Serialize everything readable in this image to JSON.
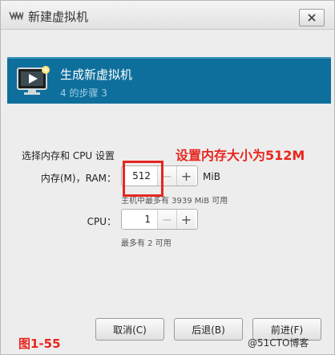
{
  "window": {
    "title": "新建虚拟机",
    "app_icon": "virt-manager-logo",
    "close_icon": "close-icon"
  },
  "banner": {
    "icon": "monitor-play-icon",
    "title": "生成新虚拟机",
    "subtitle": "4 的步骤 3"
  },
  "section": {
    "label": "选择内存和 CPU 设置"
  },
  "memory": {
    "label": "内存(M)，RAM：",
    "value": "512",
    "unit": "MiB",
    "hint": "主机中最多有 3939 MiB 可用",
    "minus": "−",
    "plus": "+"
  },
  "cpu": {
    "label": "CPU：",
    "value": "1",
    "hint": "最多有 2 可用",
    "minus": "−",
    "plus": "+"
  },
  "annotation": {
    "text": "设置内存大小为512M",
    "color": "#e8261e",
    "figure_label": "图1-55"
  },
  "footer": {
    "cancel": "取消(C)",
    "back": "后退(B)",
    "forward": "前进(F)"
  },
  "watermark": "@51CTO博客",
  "colors": {
    "banner": "#0f6f9c",
    "annotation_red": "#e8261e"
  }
}
